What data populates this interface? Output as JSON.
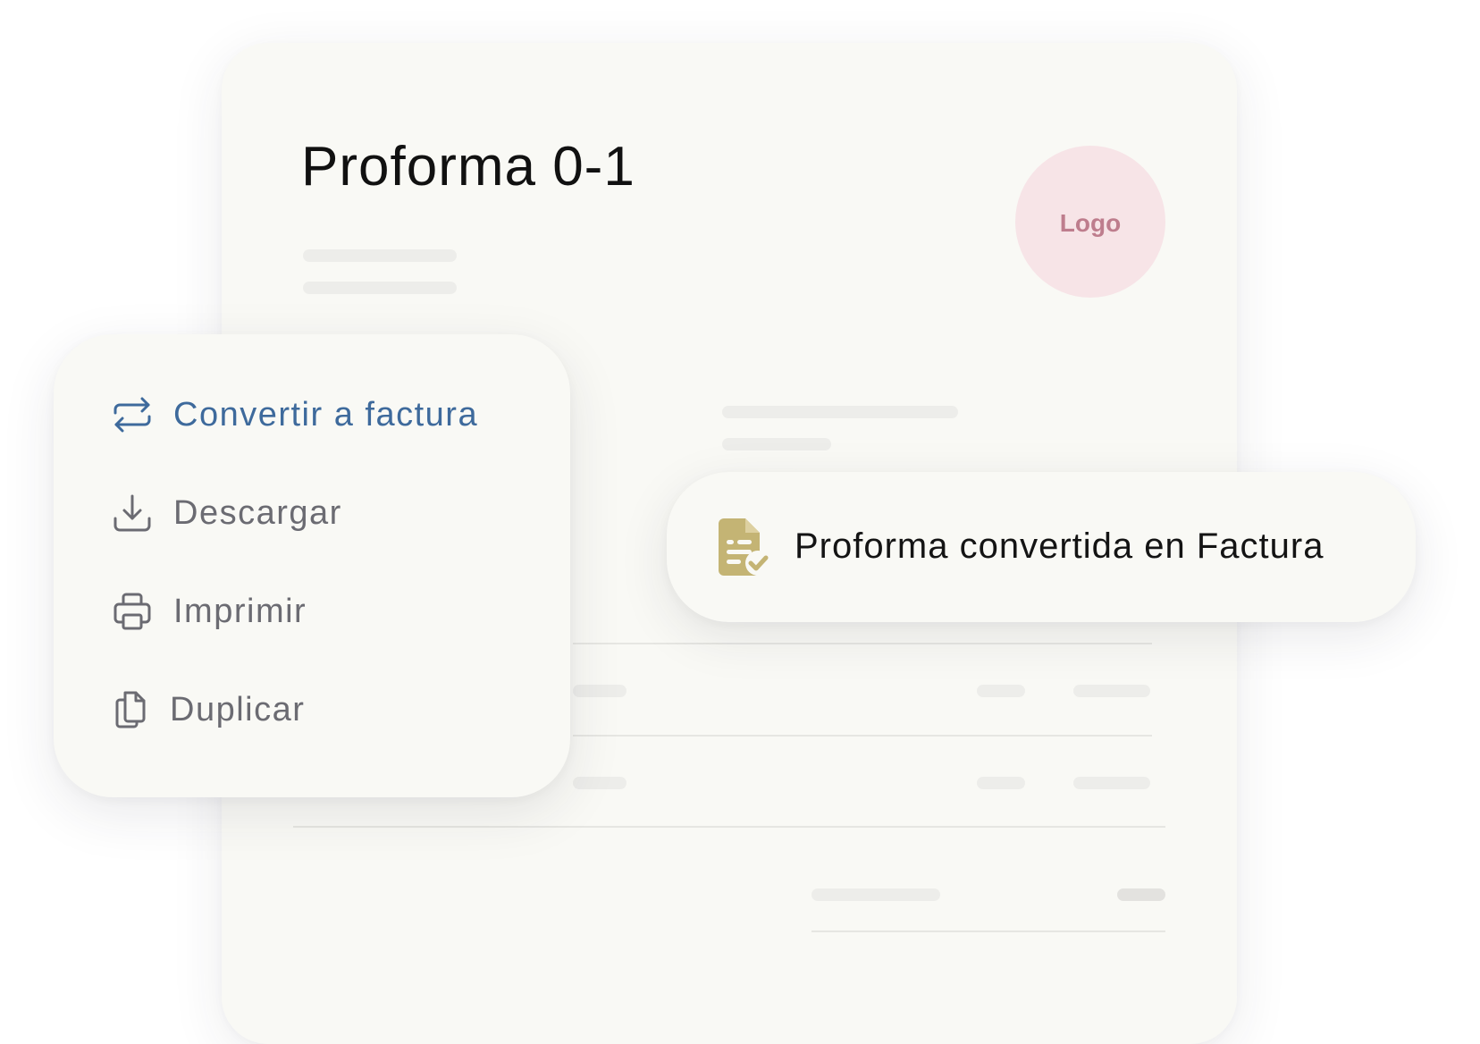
{
  "document": {
    "title": "Proforma 0-1",
    "logo_label": "Logo"
  },
  "menu": {
    "items": [
      {
        "label": "Convertir a factura",
        "icon": "convert-arrows-icon",
        "active": true
      },
      {
        "label": "Descargar",
        "icon": "download-icon",
        "active": false
      },
      {
        "label": "Imprimir",
        "icon": "printer-icon",
        "active": false
      },
      {
        "label": "Duplicar",
        "icon": "duplicate-icon",
        "active": false
      }
    ]
  },
  "toast": {
    "message": "Proforma convertida en Factura",
    "icon": "document-check-icon"
  },
  "colors": {
    "accent_blue": "#3e6a9c",
    "menu_text": "#6b6b72",
    "logo_bg": "#f7e4e7",
    "logo_text": "#be7d8d",
    "toast_icon": "#c4b474",
    "card_bg": "#f9f9f5"
  }
}
